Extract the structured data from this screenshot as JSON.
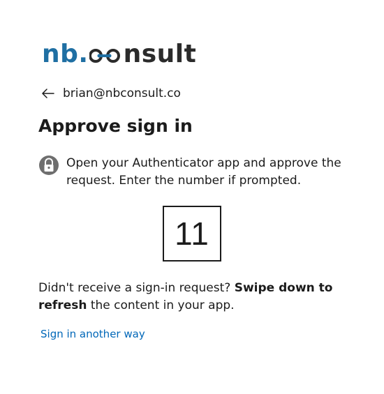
{
  "logo": {
    "part1": "nb.",
    "part2": "c",
    "part3": "nsult",
    "brand_blue": "#1f6fa3",
    "brand_dark": "#2b2b2b"
  },
  "identity": {
    "back_icon": "arrow-left-icon",
    "email": "brian@nbconsult.co"
  },
  "title": "Approve sign in",
  "instruction": {
    "icon": "lock-icon",
    "text": "Open your Authenticator app and approve the request. Enter the number if prompted."
  },
  "number": "11",
  "help": {
    "prefix": "Didn't receive a sign-in request? ",
    "bold": "Swipe down to refresh",
    "suffix": " the content in your app."
  },
  "link": {
    "label": "Sign in another way",
    "color": "#0067b8"
  }
}
